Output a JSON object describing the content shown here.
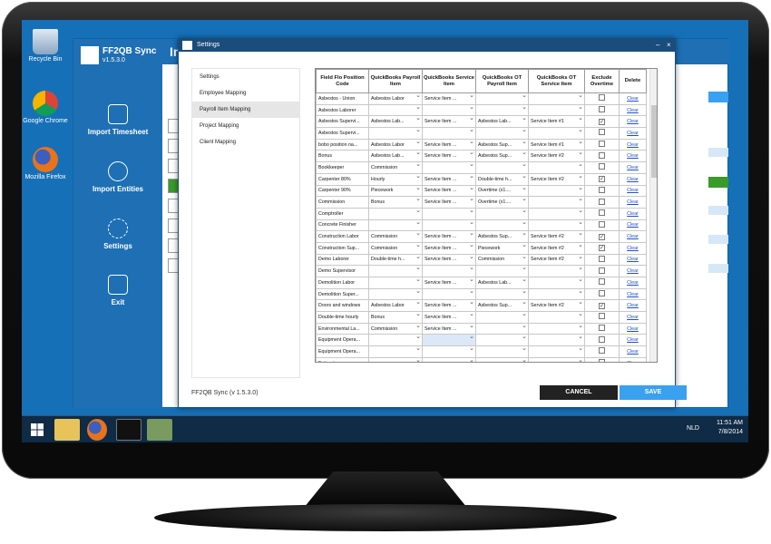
{
  "desktop": {
    "icons": [
      {
        "label": "Recycle Bin",
        "icon": "recycle-bin-icon"
      },
      {
        "label": "Google Chrome",
        "icon": "chrome-icon"
      },
      {
        "label": "Mozilla Firefox",
        "icon": "firefox-icon"
      }
    ]
  },
  "app": {
    "name": "FF2QB Sync",
    "version": "v1.5.3.0",
    "header_title": "In",
    "sidebar": [
      {
        "label": "Import Timesheet",
        "icon": "timesheet-icon"
      },
      {
        "label": "Import Entities",
        "icon": "user-icon"
      },
      {
        "label": "Settings",
        "icon": "gear-icon"
      },
      {
        "label": "Exit",
        "icon": "exit-icon"
      }
    ]
  },
  "dialog": {
    "title": "Settings",
    "minimize": "–",
    "close": "×",
    "nav": [
      "Settings",
      "Employee Mapping",
      "Payroll Item Mapping",
      "Project Mapping",
      "Client Mapping"
    ],
    "nav_active": 2,
    "columns": [
      "Field Flo Position Code",
      "QuickBooks Payroll Item",
      "QuickBooks Service Item",
      "QuickBooks OT Payroll Item",
      "QuickBooks OT Service Item",
      "Exclude Overtime",
      "Delete"
    ],
    "rows": [
      [
        "Asbestos - Union",
        "Asbestos Labor",
        "Service Item ...",
        "",
        "",
        false,
        "Clear"
      ],
      [
        "Asbestos Laborer",
        "",
        "",
        "",
        "",
        false,
        "Clear"
      ],
      [
        "Asbestos Supervi...",
        "Asbestos Lab...",
        "Service Item ...",
        "Asbestos Lab...",
        "Service Item #1",
        true,
        "Clear"
      ],
      [
        "Asbestos Supervi...",
        "",
        "",
        "",
        "",
        false,
        "Clear"
      ],
      [
        "bobo position na...",
        "Asbestos Labor",
        "Service Item ...",
        "Asbestos Sup...",
        "Service Item #1",
        false,
        "Clear"
      ],
      [
        "Bonus",
        "Asbestos Lab...",
        "Service Item ...",
        "Asbestos Sup...",
        "Service Item #2",
        false,
        "Clear"
      ],
      [
        "Bookkeeper",
        "Commission",
        "",
        "",
        "",
        false,
        "Clear"
      ],
      [
        "Carpenter 80%",
        "Hourly",
        "Service Item ...",
        "Double-time h...",
        "Service Item #2",
        true,
        "Clear"
      ],
      [
        "Carpenter 90%",
        "Piecework",
        "Service Item ...",
        "Overtime (x1....",
        "",
        false,
        "Clear"
      ],
      [
        "Commission",
        "Bonus",
        "Service Item ...",
        "Overtime (x1....",
        "",
        false,
        "Clear"
      ],
      [
        "Comptroller",
        "",
        "",
        "",
        "",
        false,
        "Clear"
      ],
      [
        "Concrete Finisher",
        "",
        "",
        "",
        "",
        false,
        "Clear"
      ],
      [
        "Construction Labor",
        "Commission",
        "Service Item ...",
        "Asbestos Sup...",
        "Service Item #2",
        true,
        "Clear"
      ],
      [
        "Construction Sup...",
        "Commission",
        "Service Item ...",
        "Piecework",
        "Service Item #2",
        true,
        "Clear"
      ],
      [
        "Demo Laborer",
        "Double-time h...",
        "Service Item ...",
        "Commission",
        "Service Item #2",
        false,
        "Clear"
      ],
      [
        "Demo Supervisor",
        "",
        "",
        "",
        "",
        false,
        "Clear"
      ],
      [
        "Demolition Labor",
        "",
        "Service Item ...",
        "Asbestos Lab...",
        "",
        false,
        "Clear"
      ],
      [
        "Demolition Super...",
        "",
        "",
        "",
        "",
        false,
        "Clear"
      ],
      [
        "Doors and windows",
        "Asbestos Labor",
        "Service Item ...",
        "Asbestos Sup...",
        "Service Item #2",
        true,
        "Clear"
      ],
      [
        "Double-time hourly",
        "Bonus",
        "Service Item ...",
        "",
        "",
        false,
        "Clear"
      ],
      [
        "Environmental La...",
        "Commission",
        "Service Item ...",
        "",
        "",
        false,
        "Clear"
      ],
      [
        "Equipment Opera...",
        "",
        "",
        "",
        "",
        false,
        "Clear"
      ],
      [
        "Equipment Opera...",
        "",
        "",
        "",
        "",
        false,
        "Clear"
      ],
      [
        "Estimator",
        "",
        "",
        "",
        "",
        false,
        "Clear"
      ]
    ],
    "selected_cell_row": 21,
    "footer_version": "FF2QB Sync (v 1.5.3.0)",
    "cancel_label": "CANCEL",
    "save_label": "SAVE"
  },
  "taskbar": {
    "time": "11:51 AM",
    "date": "7/8/2014",
    "lang": "NLD"
  },
  "colors": {
    "desktop": "#1670b8",
    "app_blue": "#1e6fb4",
    "dialog_title": "#1a4c7c",
    "save": "#3aa0f0",
    "cancel": "#222222"
  }
}
